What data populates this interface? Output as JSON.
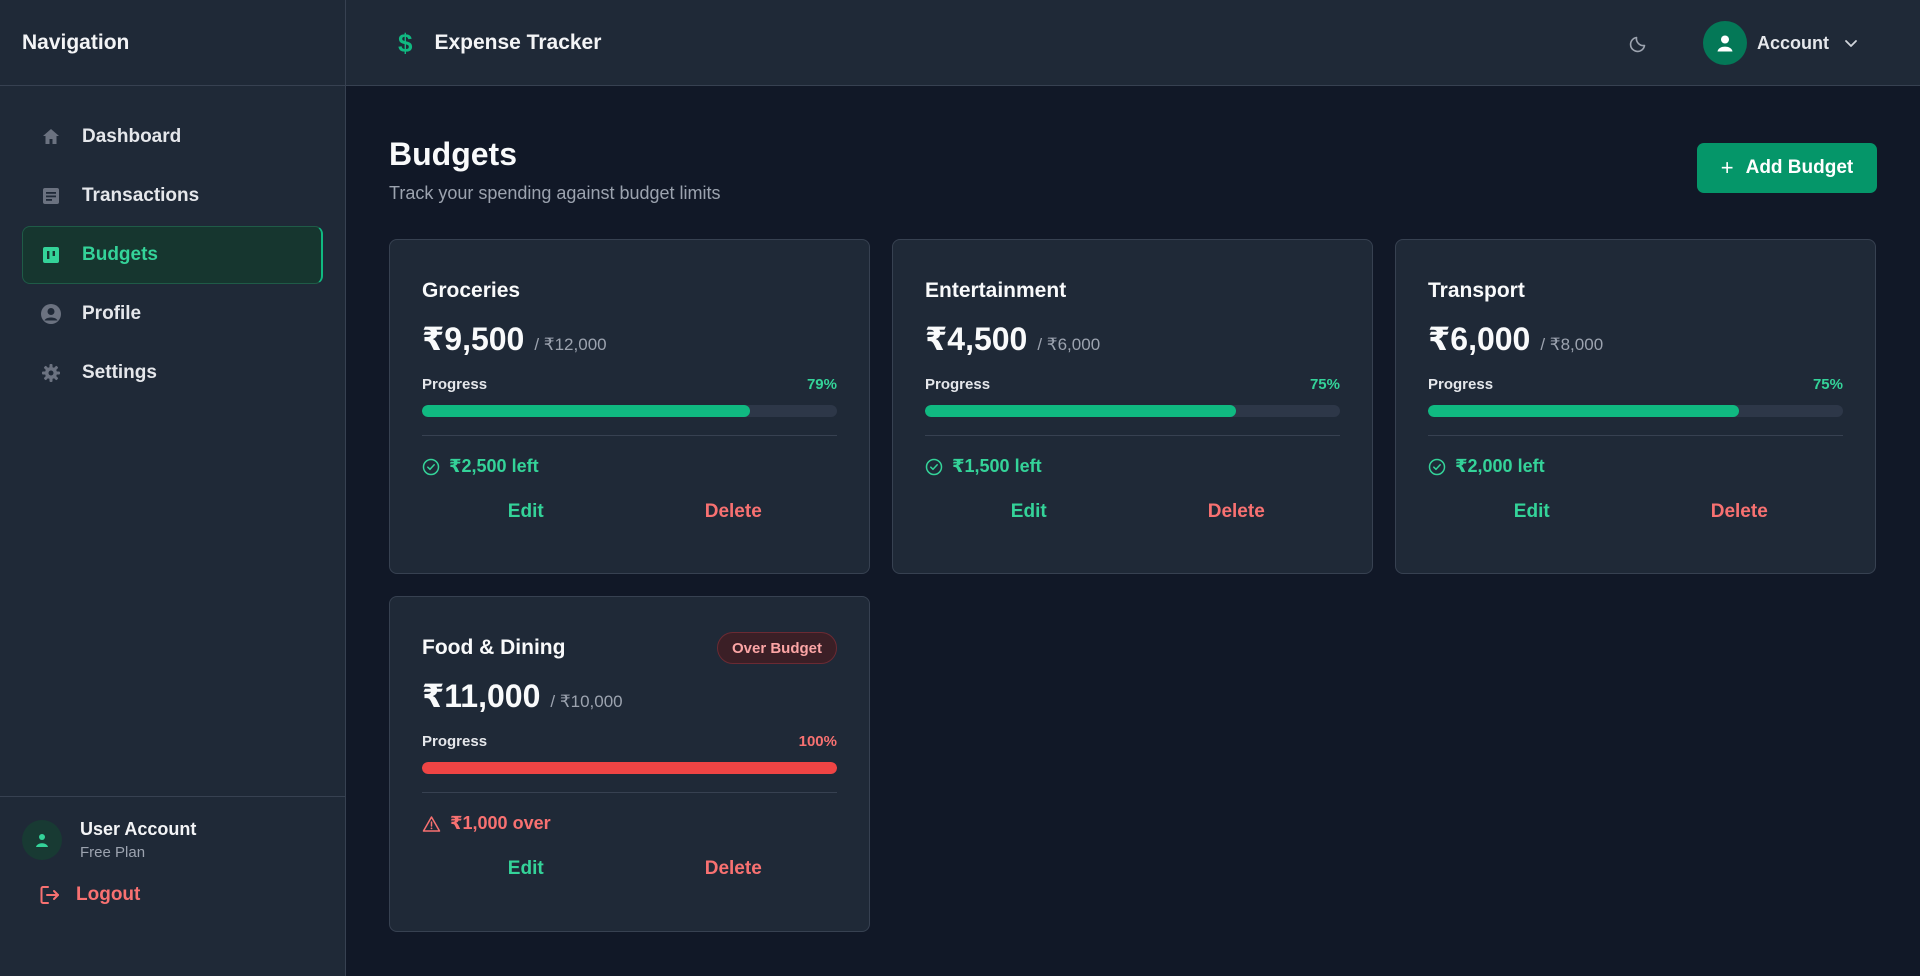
{
  "sidebar": {
    "title": "Navigation",
    "items": [
      {
        "label": "Dashboard",
        "icon": "home-icon"
      },
      {
        "label": "Transactions",
        "icon": "document-icon"
      },
      {
        "label": "Budgets",
        "icon": "chart-icon",
        "active": true
      },
      {
        "label": "Profile",
        "icon": "user-circle-icon"
      },
      {
        "label": "Settings",
        "icon": "gear-icon"
      }
    ],
    "user": {
      "name": "User Account",
      "plan": "Free Plan"
    },
    "logout_label": "Logout"
  },
  "header": {
    "brand_symbol": "$",
    "title": "Expense Tracker",
    "account_label": "Account"
  },
  "main": {
    "title": "Budgets",
    "subtitle": "Track your spending against budget limits",
    "add_button_label": "Add Budget",
    "progress_label": "Progress",
    "edit_label": "Edit",
    "delete_label": "Delete"
  },
  "budgets": [
    {
      "name": "Groceries",
      "spent": "₹9,500",
      "limit": "/ ₹12,000",
      "percent": "79%",
      "fill": 79,
      "status": "₹2,500 left",
      "over": false,
      "badge": ""
    },
    {
      "name": "Entertainment",
      "spent": "₹4,500",
      "limit": "/ ₹6,000",
      "percent": "75%",
      "fill": 75,
      "status": "₹1,500 left",
      "over": false,
      "badge": ""
    },
    {
      "name": "Transport",
      "spent": "₹6,000",
      "limit": "/ ₹8,000",
      "percent": "75%",
      "fill": 75,
      "status": "₹2,000 left",
      "over": false,
      "badge": ""
    },
    {
      "name": "Food & Dining",
      "spent": "₹11,000",
      "limit": "/ ₹10,000",
      "percent": "100%",
      "fill": 100,
      "status": "₹1,000 over",
      "over": true,
      "badge": "Over Budget"
    }
  ],
  "colors": {
    "accent": "#10b981",
    "danger": "#ef4444",
    "background": "#111827",
    "panel": "#1f2937"
  }
}
